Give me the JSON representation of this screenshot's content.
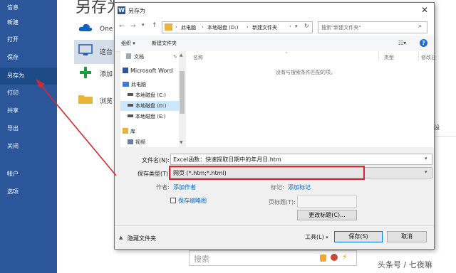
{
  "backstage": {
    "title": "另存为",
    "menu": [
      "信息",
      "新建",
      "打开",
      "保存",
      "另存为",
      "打印",
      "共享",
      "导出",
      "关闭",
      "帐户",
      "选项"
    ],
    "places": [
      "One",
      "这台",
      "添加",
      "浏览"
    ],
    "right_side_text": "设",
    "search_placeholder": "搜索",
    "watermark": "头条号 / 七夜嘛"
  },
  "dialog": {
    "title": "另存为",
    "breadcrumb": [
      "此电脑",
      "本地磁盘 (D:)",
      "新建文件夹"
    ],
    "search_placeholder": "搜索\"新建文件夹\"",
    "toolbar": {
      "organize": "组织 ▾",
      "new_folder": "新建文件夹"
    },
    "nav": [
      "文档",
      "Microsoft Word",
      "此电脑",
      "本地磁盘 (C:)",
      "本地磁盘 (D:)",
      "本地磁盘 (E:)",
      "库",
      "视频"
    ],
    "columns": {
      "name": "名称",
      "type": "类型",
      "modified": "修改日"
    },
    "empty_message": "没有与搜索条件匹配的项。",
    "filename_label": "文件名(N):",
    "filename_value": "Excel函数：快速提取日期中的年月日.htm",
    "filetype_label": "保存类型(T):",
    "filetype_value": "网页 (*.htm;*.html)",
    "authors_label": "作者:",
    "authors_value": "添加作者",
    "tags_label": "标记:",
    "tags_value": "添加标记",
    "thumbnail_label": "保存缩略图",
    "page_title_label": "页标题(T):",
    "change_title_button": "更改标题(C)...",
    "hide_folders": "隐藏文件夹",
    "tools_button": "工具(L)",
    "save_button": "保存(S)",
    "cancel_button": "取消"
  },
  "colors": {
    "sidebar": "#2b579a",
    "highlight_box": "#d9272e",
    "arrow": "#d9272e",
    "link": "#0066cc"
  }
}
